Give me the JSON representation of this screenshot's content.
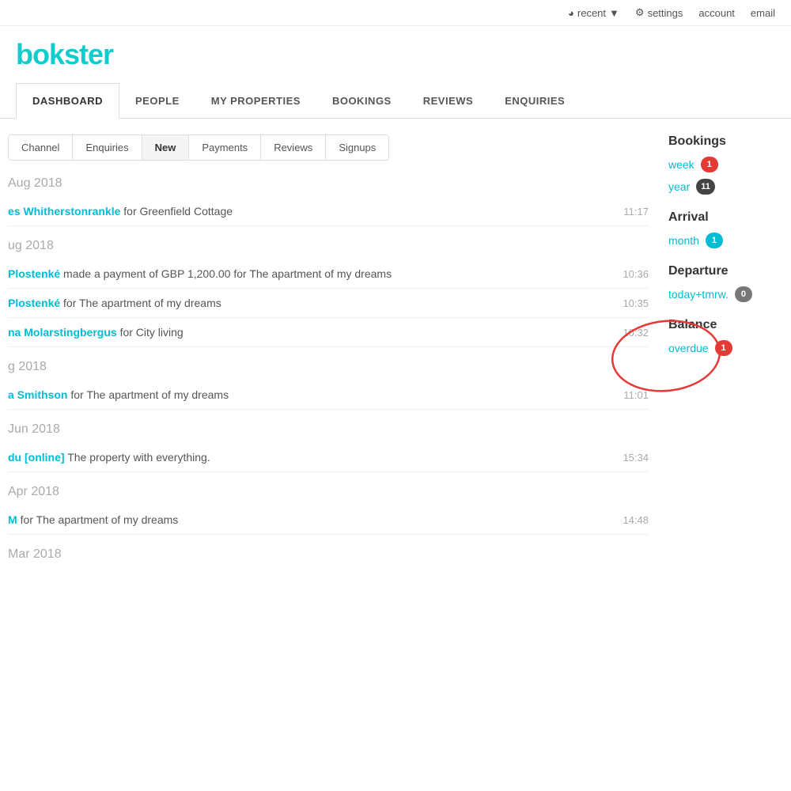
{
  "topbar": {
    "recent_label": "recent",
    "settings_label": "settings",
    "account_label": "account",
    "email_label": "email"
  },
  "logo": {
    "text": "okster"
  },
  "main_nav": {
    "items": [
      {
        "label": "DASHBOARD",
        "active": true
      },
      {
        "label": "PEOPLE",
        "active": false
      },
      {
        "label": "MY PROPERTIES",
        "active": false
      },
      {
        "label": "BOOKINGS",
        "active": false
      },
      {
        "label": "REVIEWS",
        "active": false
      },
      {
        "label": "ENQUIRIES",
        "active": false
      }
    ]
  },
  "sub_tabs": {
    "items": [
      {
        "label": "Channel"
      },
      {
        "label": "Enquiries"
      },
      {
        "label": "New",
        "active": true
      },
      {
        "label": "Payments"
      },
      {
        "label": "Reviews"
      },
      {
        "label": "Signups"
      }
    ]
  },
  "activity": {
    "groups": [
      {
        "date": "Aug 2018",
        "items": [
          {
            "name": "es Whitherstonrankle",
            "detail": " for Greenfield Cottage",
            "time": "11:17"
          }
        ]
      },
      {
        "date": "ug 2018",
        "items": [
          {
            "name": "Plostenké",
            "detail": " made a payment of GBP 1,200.00 for The apartment of my dreams",
            "time": "10:36"
          },
          {
            "name": "Plostenké",
            "detail": " for The apartment of my dreams",
            "time": "10:35"
          },
          {
            "name": "na Molarstingbergus",
            "detail": " for City living",
            "time": "10:32"
          }
        ]
      },
      {
        "date": "g 2018",
        "items": [
          {
            "name": "a Smithson",
            "detail": " for The apartment of my dreams",
            "time": "11:01"
          }
        ]
      },
      {
        "date": "Jun 2018",
        "items": [
          {
            "name": "du [online]",
            "detail": " The property with everything.",
            "time": "15:34"
          }
        ]
      },
      {
        "date": "Apr 2018",
        "items": [
          {
            "name": "M",
            "detail": " for The apartment of my dreams",
            "time": "14:48"
          }
        ]
      },
      {
        "date": "Mar 2018",
        "items": []
      }
    ]
  },
  "sidebar": {
    "bookings_title": "Bookings",
    "bookings_links": [
      {
        "label": "week",
        "badge": "1",
        "badge_type": "red"
      },
      {
        "label": "year",
        "badge": "11",
        "badge_type": "dark"
      }
    ],
    "arrival_title": "Arrival",
    "arrival_links": [
      {
        "label": "month",
        "badge": "1",
        "badge_type": "teal"
      }
    ],
    "departure_title": "Departure",
    "departure_links": [
      {
        "label": "today+tmrw.",
        "badge": "",
        "badge_type": "gray"
      }
    ],
    "balance_title": "Balance",
    "balance_links": [
      {
        "label": "overdue",
        "badge": "1",
        "badge_type": "red"
      }
    ]
  }
}
